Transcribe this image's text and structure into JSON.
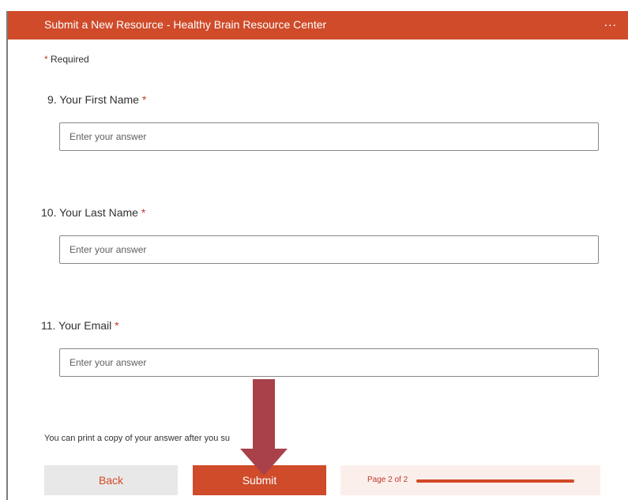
{
  "header": {
    "title": "Submit a New Resource - Healthy Brain Resource Center",
    "more_glyph": "...",
    "color": "#cf4b2a"
  },
  "form": {
    "required_asterisk": "*",
    "required_label": "Required",
    "questions": [
      {
        "label": "9. Your First Name",
        "asterisk": "*",
        "placeholder": "Enter your answer"
      },
      {
        "label": "10. Your Last Name",
        "asterisk": "*",
        "placeholder": "Enter your answer"
      },
      {
        "label": "11. Your Email",
        "asterisk": "*",
        "placeholder": "Enter your answer"
      }
    ],
    "print_note": "You can print a copy of your answer after you su"
  },
  "footer": {
    "back_label": "Back",
    "submit_label": "Submit",
    "page_indicator": "Page 2 of 2",
    "progress_fraction": 1.0
  },
  "annotation": {
    "arrow_icon": "down-arrow-icon",
    "arrow_color": "#a8414a"
  }
}
